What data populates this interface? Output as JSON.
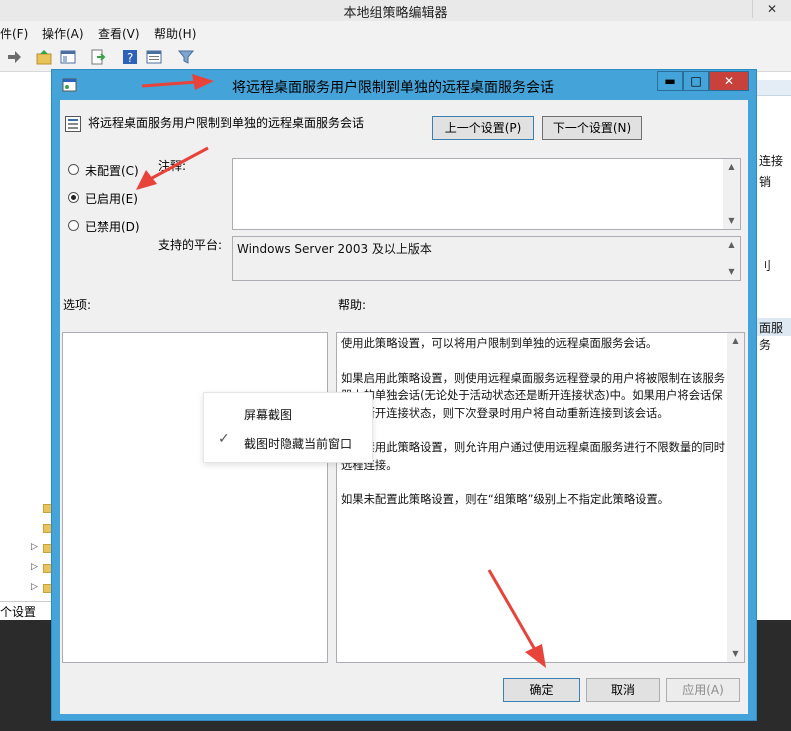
{
  "background_window": {
    "title": "本地组策略编辑器",
    "close_glyph": "✕",
    "menu": [
      "件(F)",
      "操作(A)",
      "查看(V)",
      "帮助(H)"
    ],
    "status_text": "个设置",
    "right_panel_texts": [
      "连接",
      "销",
      "刂",
      "面服务"
    ]
  },
  "dialog": {
    "title": "将远程桌面服务用户限制到单独的远程桌面服务会话",
    "policy_name": "将远程桌面服务用户限制到单独的远程桌面服务会话",
    "prev_button": "上一个设置(P)",
    "next_button": "下一个设置(N)",
    "radios": [
      {
        "label": "未配置(C)",
        "selected": false
      },
      {
        "label": "已启用(E)",
        "selected": true
      },
      {
        "label": "已禁用(D)",
        "selected": false
      }
    ],
    "comment_label": "注释:",
    "comment_value": "",
    "platform_label": "支持的平台:",
    "platform_value": "Windows Server 2003 及以上版本",
    "options_label": "选项:",
    "help_label": "帮助:",
    "help_paragraphs": [
      "使用此策略设置，可以将用户限制到单独的远程桌面服务会话。",
      "如果启用此策略设置，则使用远程桌面服务远程登录的用户将被限制在该服务器上的单独会话(无论处于活动状态还是断开连接状态)中。如果用户将会话保持在断开连接状态，则下次登录时用户将自动重新连接到该会话。",
      "如果禁用此策略设置，则允许用户通过使用远程桌面服务进行不限数量的同时远程连接。",
      "如果未配置此策略设置，则在“组策略”级别上不指定此策略设置。"
    ],
    "ok_button": "确定",
    "cancel_button": "取消",
    "apply_button": "应用(A)",
    "min_glyph": "▬",
    "max_glyph": "□",
    "close_glyph": "✕"
  },
  "context_menu": {
    "items": [
      "屏幕截图",
      "截图时隐藏当前窗口"
    ],
    "checked_index": 1,
    "check_glyph": "✓"
  },
  "colors": {
    "dialog_frame": "#44a3d8",
    "annotation_arrow": "#e8433a",
    "close_button": "#c8413a"
  }
}
